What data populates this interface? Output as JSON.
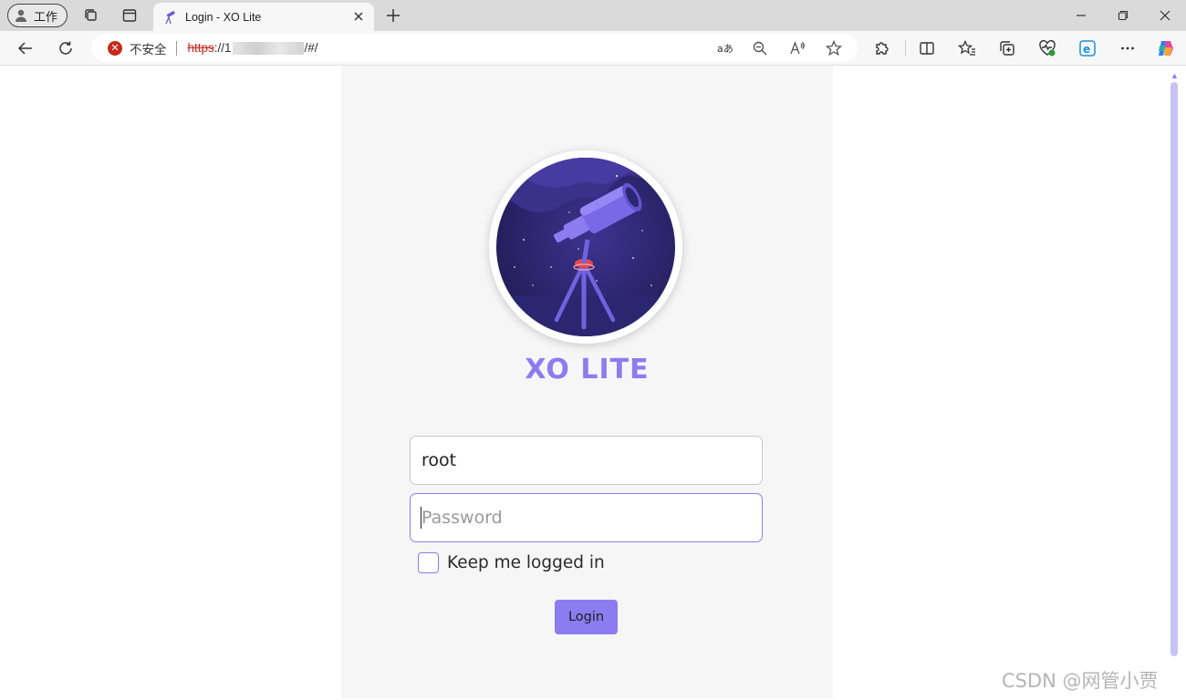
{
  "browser": {
    "profile_label": "工作",
    "tab_title": "Login - XO Lite",
    "security_label": "不安全",
    "url_scheme": "https",
    "url_host_prefix": "://1",
    "url_path": "/#/",
    "icons": {
      "profile": "avatar-icon",
      "workspaces": "workspaces-icon",
      "tab_actions": "tab-actions-icon",
      "tab_close": "close-icon",
      "new_tab": "plus-icon",
      "back": "back-arrow-icon",
      "refresh": "refresh-icon",
      "security": "not-secure-icon",
      "read_aloud_translate": "translate-icon",
      "zoom": "zoom-out-icon",
      "read_aloud": "read-aloud-icon",
      "favorite": "star-icon",
      "extensions": "puzzle-icon",
      "split": "split-screen-icon",
      "favorites": "favorites-icon",
      "collections": "collections-icon",
      "performance": "heart-pulse-icon",
      "edge": "edge-icon",
      "more": "more-icon",
      "copilot": "copilot-icon"
    }
  },
  "page": {
    "brand": "XO LITE",
    "username_value": "root",
    "password_placeholder": "Password",
    "remember_label": "Keep me logged in",
    "login_label": "Login",
    "colors": {
      "accent": "#8c7cf0",
      "panel": "#f6f6f6"
    }
  },
  "watermark": "CSDN @网管小贾"
}
